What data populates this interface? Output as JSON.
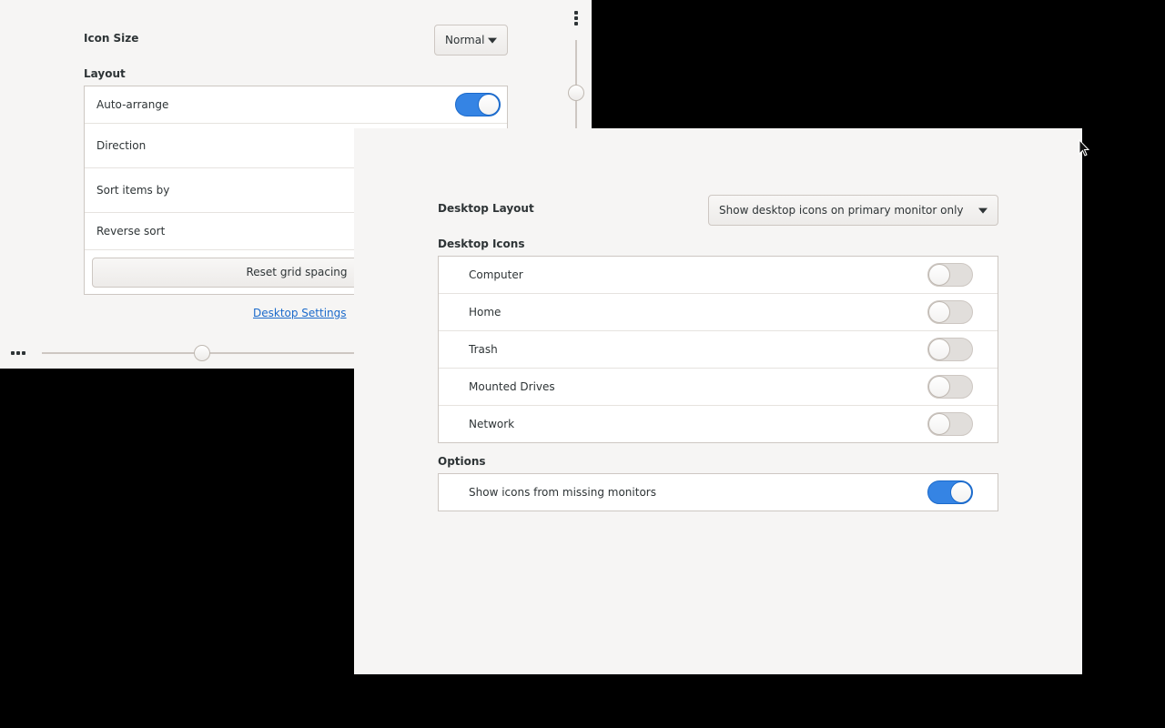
{
  "back_window": {
    "icon_size": {
      "label": "Icon Size",
      "value": "Normal"
    },
    "layout": {
      "label": "Layout",
      "auto_arrange": {
        "label": "Auto-arrange",
        "on": true
      },
      "direction": {
        "label": "Direction"
      },
      "sort_items_by": {
        "label": "Sort items by"
      },
      "reverse_sort": {
        "label": "Reverse sort"
      },
      "reset_button": "Reset grid spacing"
    },
    "desktop_settings_link": "Desktop Settings"
  },
  "front_window": {
    "desktop_layout": {
      "label": "Desktop Layout",
      "value": "Show desktop icons on primary monitor only"
    },
    "desktop_icons": {
      "label": "Desktop Icons",
      "items": [
        {
          "label": "Computer",
          "on": false
        },
        {
          "label": "Home",
          "on": false
        },
        {
          "label": "Trash",
          "on": false
        },
        {
          "label": "Mounted Drives",
          "on": false
        },
        {
          "label": "Network",
          "on": false
        }
      ]
    },
    "options": {
      "label": "Options",
      "items": [
        {
          "label": "Show icons from missing monitors",
          "on": true
        }
      ]
    }
  },
  "colors": {
    "accent": "#3584e4",
    "window_bg": "#f6f5f4",
    "desktop_bg": "#000000",
    "link": "#1b6acb"
  },
  "icons": [
    "vertical-ellipsis-icon",
    "horizontal-ellipsis-icon",
    "mouse-pointer-icon",
    "dropdown-arrow-icon"
  ]
}
